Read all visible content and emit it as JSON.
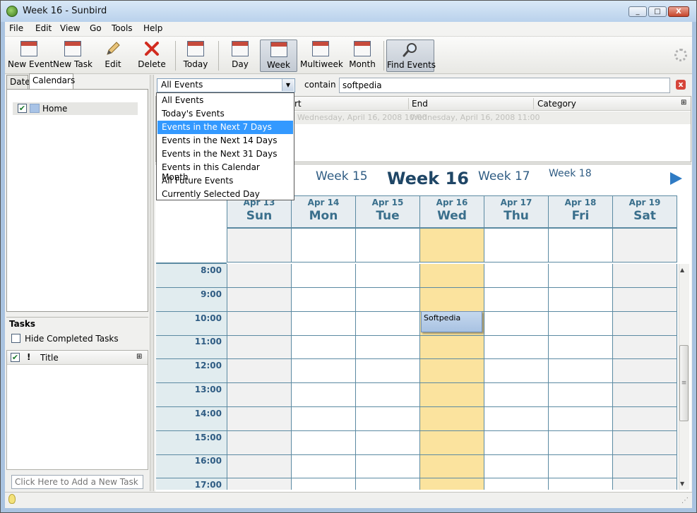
{
  "window": {
    "title": "Week 16 - Sunbird",
    "minimize": "_",
    "maximize": "□",
    "close": "X"
  },
  "menu": [
    "File",
    "Edit",
    "View",
    "Go",
    "Tools",
    "Help"
  ],
  "toolbar": {
    "new_event": "New Event",
    "new_task": "New Task",
    "edit": "Edit",
    "delete": "Delete",
    "today": "Today",
    "day": "Day",
    "week": "Week",
    "multiweek": "Multiweek",
    "month": "Month",
    "find_events": "Find Events",
    "active_view": "Week"
  },
  "left_pane": {
    "tabs": [
      "Date",
      "Calendars"
    ],
    "selected_tab": "Calendars",
    "calendars": [
      {
        "name": "Home",
        "checked": true,
        "color": "#a8c3e6"
      }
    ]
  },
  "tasks": {
    "title": "Tasks",
    "hide_completed_label": "Hide Completed Tasks",
    "hide_completed_checked": false,
    "columns": {
      "done": "✔",
      "priority": "!",
      "title": "Title"
    },
    "new_task_placeholder": "Click Here to Add a New Task"
  },
  "search": {
    "filter_value": "All Events",
    "contain_label": "contain",
    "query": "softpedia",
    "clear": "x"
  },
  "filter_options": [
    "All Events",
    "Today's Events",
    "Events in the Next 7 Days",
    "Events in the Next 14 Days",
    "Events in the Next 31 Days",
    "Events in this Calendar Month",
    "All Future Events",
    "Currently Selected Day"
  ],
  "filter_highlighted": "Events in the Next 7 Days",
  "results": {
    "columns": [
      "rt",
      "End",
      "Category"
    ],
    "rows": [
      {
        "start": "Wednesday, April 16, 2008 10:00",
        "end": "Wednesday, April 16, 2008 11:00",
        "category": ""
      }
    ]
  },
  "week_nav": {
    "prev": "Week 15",
    "current": "Week 16",
    "next": "Week 17",
    "next2": "Week 18"
  },
  "days": [
    {
      "date": "Apr 13",
      "name": "Sun"
    },
    {
      "date": "Apr 14",
      "name": "Mon"
    },
    {
      "date": "Apr 15",
      "name": "Tue"
    },
    {
      "date": "Apr 16",
      "name": "Wed"
    },
    {
      "date": "Apr 17",
      "name": "Thu"
    },
    {
      "date": "Apr 18",
      "name": "Fri"
    },
    {
      "date": "Apr 19",
      "name": "Sat"
    }
  ],
  "today_index": 3,
  "hours": [
    "8:00",
    "9:00",
    "10:00",
    "11:00",
    "12:00",
    "13:00",
    "14:00",
    "15:00",
    "16:00",
    "17:00"
  ],
  "event": {
    "title": "Softpedia",
    "day": "Wed",
    "start": "10:00",
    "end": "11:00"
  },
  "colors": {
    "today": "#fbe39e",
    "grid_line": "#5b8aa2",
    "event": "#a8c2e2",
    "selection": "#3399ff"
  }
}
